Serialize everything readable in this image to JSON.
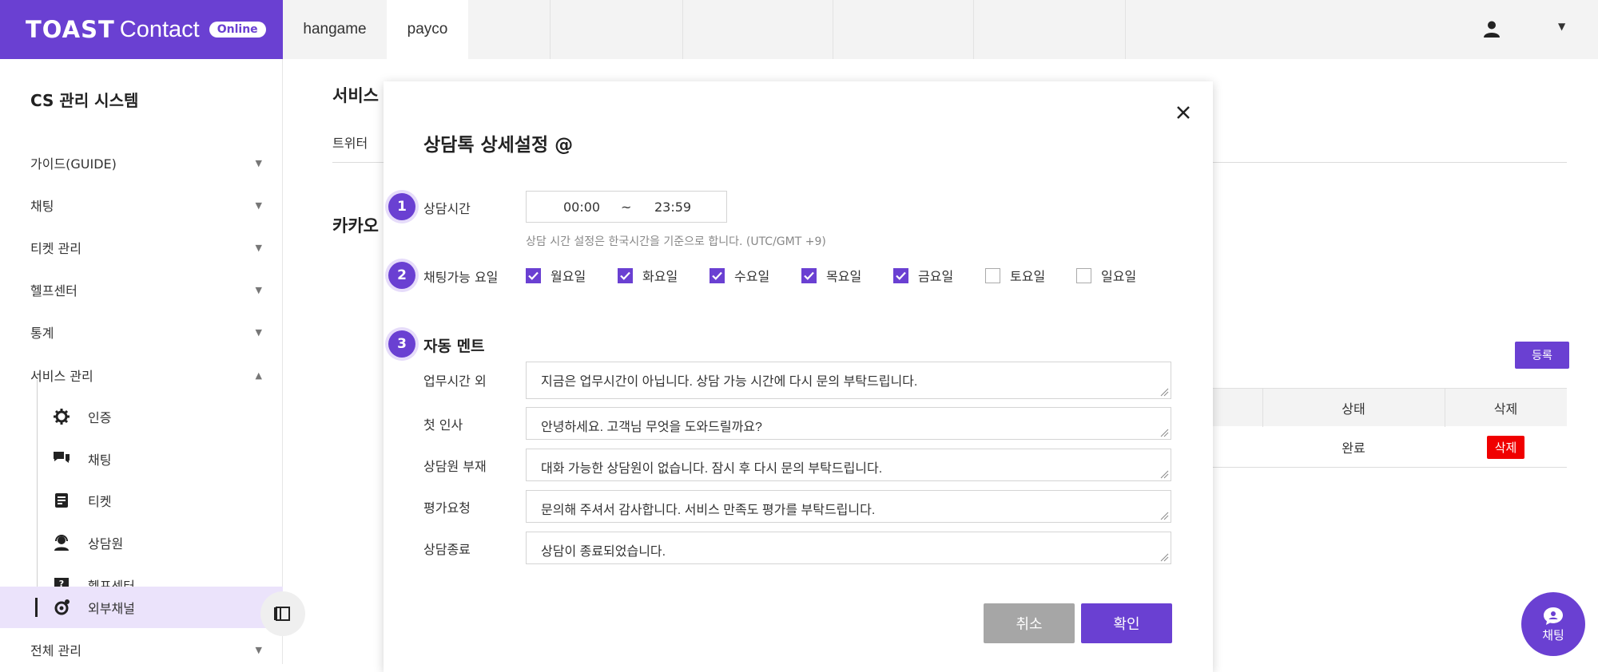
{
  "brand": {
    "logo_strong": "TOAST",
    "logo_light": "Contact",
    "badge": "Online"
  },
  "tabs": [
    {
      "label": "hangame"
    },
    {
      "label": "payco"
    }
  ],
  "sidebar": {
    "title": "CS 관리 시스템",
    "items": [
      {
        "label": "가이드(GUIDE)"
      },
      {
        "label": "채팅"
      },
      {
        "label": "티켓 관리"
      },
      {
        "label": "헬프센터"
      },
      {
        "label": "통계"
      },
      {
        "label": "서비스 관리"
      }
    ],
    "sub_items": [
      {
        "label": "인증",
        "icon": "gear-icon"
      },
      {
        "label": "채팅",
        "icon": "chat-icon"
      },
      {
        "label": "티켓",
        "icon": "document-icon"
      },
      {
        "label": "상담원",
        "icon": "agent-icon"
      },
      {
        "label": "헬프센터",
        "icon": "help-icon"
      },
      {
        "label": "외부채널",
        "icon": "channel-icon"
      }
    ],
    "bottom_item": {
      "label": "전체 관리"
    }
  },
  "background": {
    "title": "서비스",
    "tab": "트위터",
    "section": "카카오",
    "register_button": "등록",
    "table": {
      "headers": [
        "상태",
        "삭제"
      ],
      "row": {
        "status": "완료",
        "delete": "삭제"
      }
    },
    "chat_fab": "채팅"
  },
  "modal": {
    "title": "상담톡 상세설정 @",
    "steps": [
      "1",
      "2",
      "3"
    ],
    "consult_time": {
      "label": "상담시간",
      "start": "00:00",
      "separator": "~",
      "end": "23:59",
      "hint": "상담 시간 설정은 한국시간을 기준으로 합니다. (UTC/GMT +9)"
    },
    "days": {
      "label": "채팅가능 요일",
      "items": [
        {
          "label": "월요일",
          "checked": true
        },
        {
          "label": "화요일",
          "checked": true
        },
        {
          "label": "수요일",
          "checked": true
        },
        {
          "label": "목요일",
          "checked": true
        },
        {
          "label": "금요일",
          "checked": true
        },
        {
          "label": "토요일",
          "checked": false
        },
        {
          "label": "일요일",
          "checked": false
        }
      ]
    },
    "auto_message": {
      "label": "자동 멘트",
      "fields": [
        {
          "label": "업무시간 외",
          "value": "지금은 업무시간이 아닙니다. 상담 가능 시간에 다시 문의 부탁드립니다."
        },
        {
          "label": "첫 인사",
          "value": "안녕하세요. 고객님 무엇을 도와드릴까요?"
        },
        {
          "label": "상담원 부재",
          "value": "대화 가능한 상담원이 없습니다. 잠시 후 다시 문의 부탁드립니다."
        },
        {
          "label": "평가요청",
          "value": "문의해 주셔서 감사합니다. 서비스 만족도 평가를 부탁드립니다."
        },
        {
          "label": "상담종료",
          "value": "상담이 종료되었습니다."
        }
      ]
    },
    "cancel_label": "취소",
    "confirm_label": "확인"
  },
  "colors": {
    "accent": "#6a40d2",
    "danger": "#f00000",
    "active_bg": "#ebe3fb"
  }
}
